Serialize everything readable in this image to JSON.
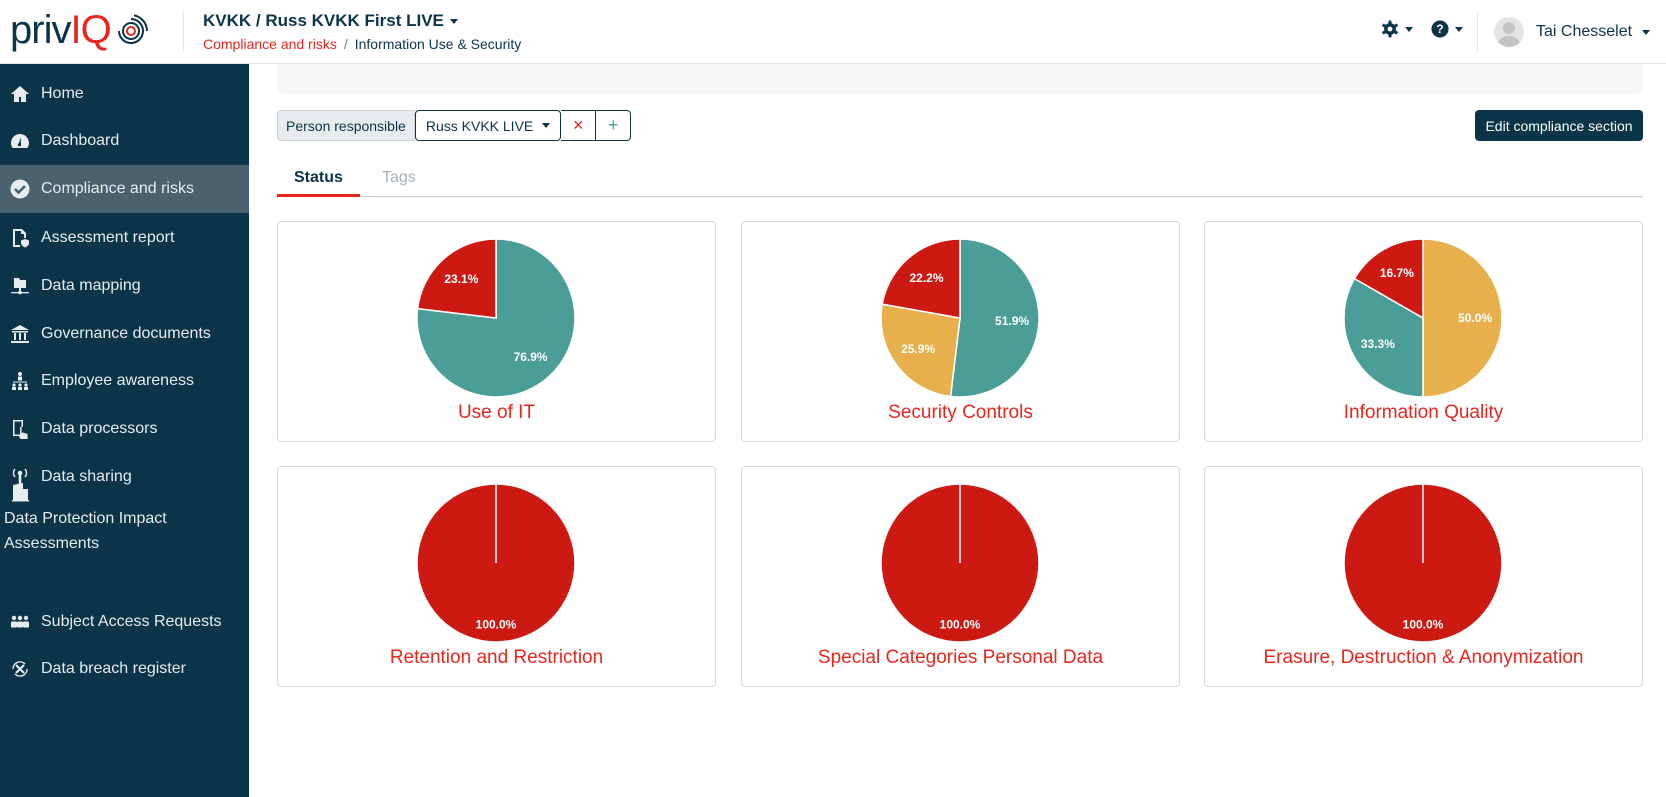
{
  "header": {
    "logo_text": "privIQ",
    "project": "KVKK / Russ KVKK First LIVE",
    "breadcrumb": [
      "Compliance and risks",
      "Information Use & Security"
    ],
    "user_name": "Tai Chesselet",
    "icons": [
      "gear-icon",
      "help-icon"
    ]
  },
  "sidebar": {
    "items": [
      {
        "label": "Home",
        "icon": "home-icon"
      },
      {
        "label": "Dashboard",
        "icon": "dashboard-icon"
      },
      {
        "label": "Compliance and risks",
        "icon": "check-circle-icon",
        "active": true
      },
      {
        "label": "Assessment report",
        "icon": "report-icon"
      },
      {
        "label": "Data mapping",
        "icon": "network-folder-icon"
      },
      {
        "label": "Governance documents",
        "icon": "bank-icon"
      },
      {
        "label": "Employee awareness",
        "icon": "org-chart-icon"
      },
      {
        "label": "Data processors",
        "icon": "tablet-hand-icon"
      },
      {
        "label": "Data sharing",
        "icon": "broadcast-icon"
      },
      {
        "label": "Data Protection Impact Assessments",
        "icon": "building-icon"
      },
      {
        "label": "Subject Access Requests",
        "icon": "users-icon"
      },
      {
        "label": "Data breach register",
        "icon": "breach-icon"
      }
    ]
  },
  "filter": {
    "label": "Person responsible",
    "value": "Russ KVKK LIVE",
    "remove": "×",
    "add": "+"
  },
  "edit_button": "Edit compliance section",
  "tabs": [
    {
      "label": "Status",
      "active": true
    },
    {
      "label": "Tags",
      "active": false
    }
  ],
  "colors": {
    "green": "#4b9d98",
    "red": "#cc1a12",
    "yellow": "#e8b04c",
    "title": "#e8261e",
    "sidebar": "#0b3449"
  },
  "chart_data": [
    {
      "type": "pie",
      "title": "Use of IT",
      "slices": [
        {
          "color": "green",
          "value": 76.9,
          "label": "76.9%"
        },
        {
          "color": "red",
          "value": 23.1,
          "label": "23.1%"
        }
      ]
    },
    {
      "type": "pie",
      "title": "Security Controls",
      "slices": [
        {
          "color": "green",
          "value": 51.9,
          "label": "51.9%"
        },
        {
          "color": "yellow",
          "value": 25.9,
          "label": "25.9%"
        },
        {
          "color": "red",
          "value": 22.2,
          "label": "22.2%"
        }
      ]
    },
    {
      "type": "pie",
      "title": "Information Quality",
      "slices": [
        {
          "color": "yellow",
          "value": 50.0,
          "label": "50.0%"
        },
        {
          "color": "green",
          "value": 33.3,
          "label": "33.3%"
        },
        {
          "color": "red",
          "value": 16.7,
          "label": "16.7%"
        }
      ]
    },
    {
      "type": "pie",
      "title": "Retention and Restriction",
      "slices": [
        {
          "color": "red",
          "value": 100.0,
          "label": "100.0%"
        }
      ]
    },
    {
      "type": "pie",
      "title": "Special Categories Personal Data",
      "slices": [
        {
          "color": "red",
          "value": 100.0,
          "label": "100.0%"
        }
      ]
    },
    {
      "type": "pie",
      "title": "Erasure, Destruction & Anonymization",
      "slices": [
        {
          "color": "red",
          "value": 100.0,
          "label": "100.0%"
        }
      ]
    }
  ]
}
